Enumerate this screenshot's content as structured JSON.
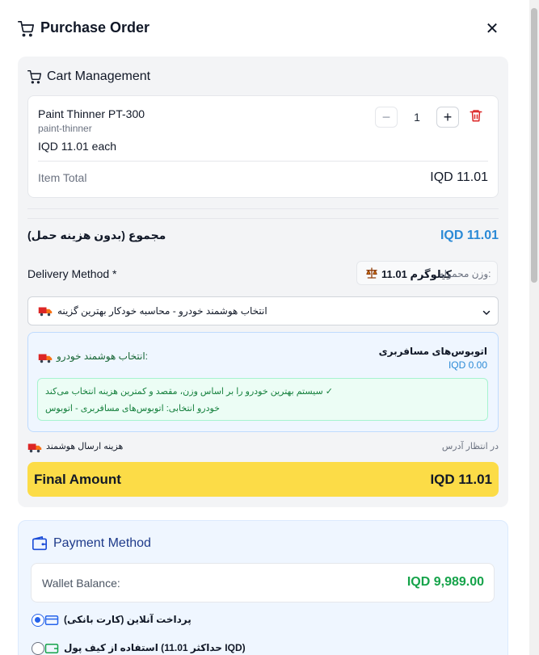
{
  "header": {
    "title": "Purchase Order",
    "close_icon": "close-icon",
    "cart_icon": "cart-icon"
  },
  "cart": {
    "section_title": "Cart Management",
    "item": {
      "name": "Paint Thinner PT-300",
      "slug": "paint-thinner",
      "unit_price": "IQD 11.01 each",
      "quantity": "1",
      "total_label": "Item Total",
      "total_value": "IQD 11.01"
    },
    "subtotal_label": "مجموع (بدون هزینه حمل)",
    "subtotal_value": "IQD 11.01",
    "delivery_label": "Delivery Method *",
    "weight_label": "وزن محموله:",
    "weight_value": "11.01 کیلوگرم",
    "delivery_select": "انتخاب هوشمند خودرو - محاسبه خودکار بهترین گزینه",
    "smart_label": "انتخاب هوشمند خودرو:",
    "vehicle_name": "اتوبوس‌های مسافربری",
    "vehicle_price": "IQD 0.00",
    "smart_note_1": "سیستم بهترین خودرو را بر اساس وزن، مقصد و کمترین هزینه انتخاب می‌کند ✓",
    "smart_note_2": "خودرو انتخابی: اتوبوس‌های مسافربری - اتوبوس",
    "smart_shipping_label": "هزینه ارسال هوشمند",
    "awaiting_address": "در انتظار آدرس",
    "final_label": "Final Amount",
    "final_value": "IQD 11.01"
  },
  "payment": {
    "section_title": "Payment Method",
    "wallet_label": "Wallet Balance:",
    "wallet_value": "IQD 9,989.00",
    "option_online": "پرداخت آنلاین (کارت بانکی)",
    "option_wallet": "استفاده از کیف پول (حداکثر 11.01 IQD)"
  },
  "colors": {
    "accent_blue": "#2b8ad6",
    "final_bar": "#fcdc47",
    "wallet_green": "#16a34a",
    "danger": "#dc2626"
  }
}
